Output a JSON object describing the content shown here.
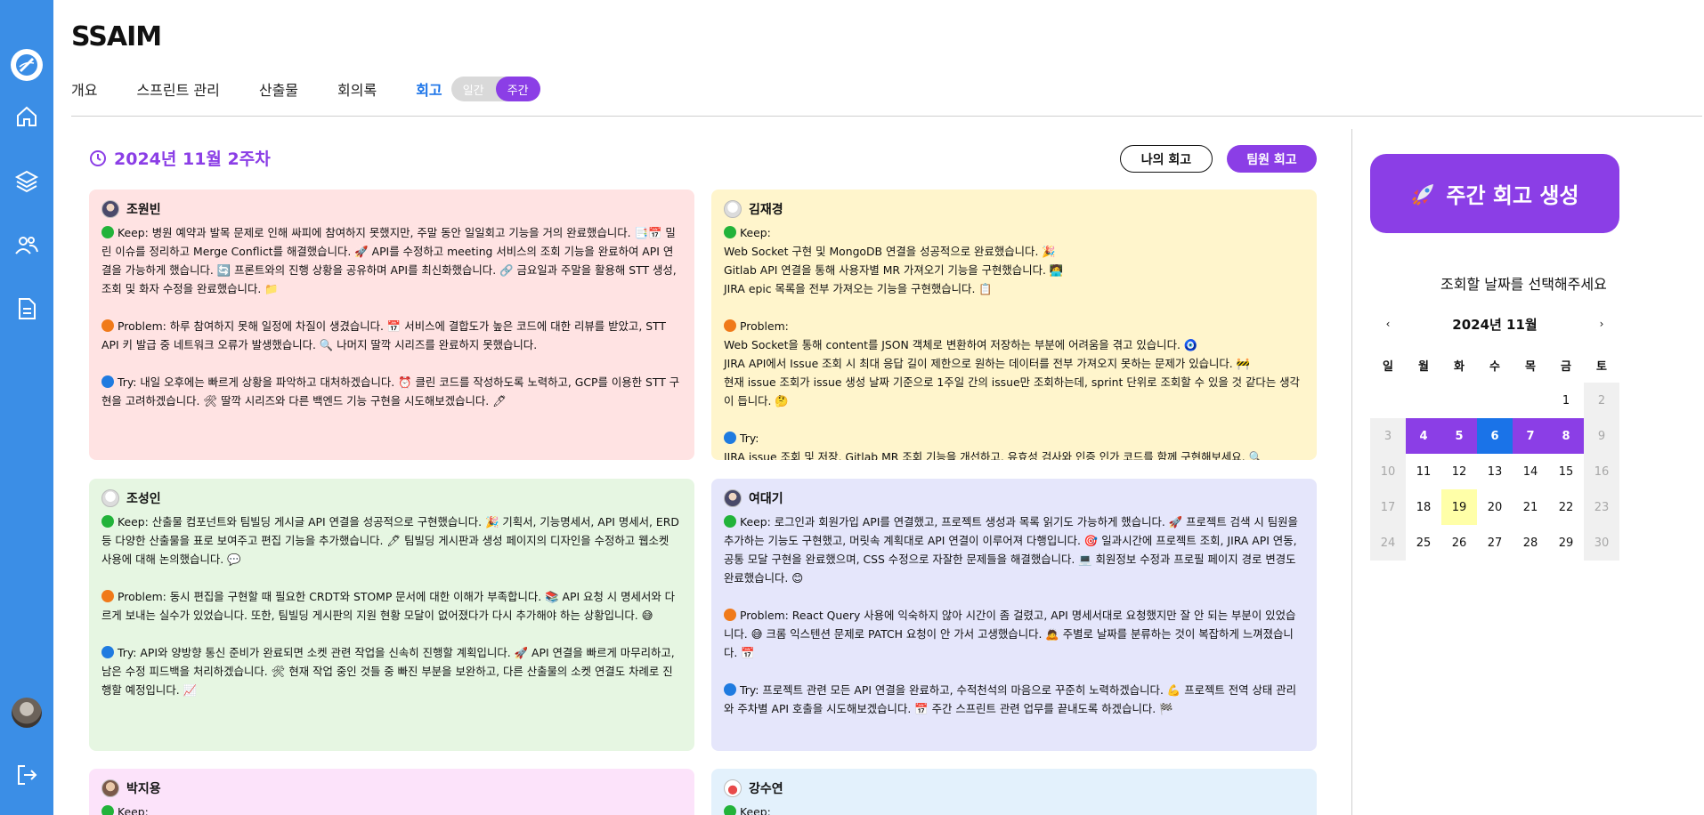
{
  "app": {
    "title": "SSAIM"
  },
  "tabs": [
    {
      "label": "개요"
    },
    {
      "label": "스프린트 관리"
    },
    {
      "label": "산출물"
    },
    {
      "label": "회의록"
    },
    {
      "label": "회고"
    }
  ],
  "toggle": {
    "daily": "일간",
    "weekly": "주간",
    "selected": "주간"
  },
  "week_label": "2024년 11월 2주차",
  "buttons": {
    "mine": "나의 회고",
    "team": "팀원 회고",
    "generate": "주간 회고 생성"
  },
  "cards": [
    {
      "name": "조원빈",
      "paras": [
        "Keep: 병원 예약과 발목 문제로 인해 싸피에 참여하지 못했지만, 주말 동안 일일회고 기능을 거의 완료했습니다. 📑📅 밀린 이슈를 정리하고 Merge Conflict를 해결했습니다. 🚀 API를 수정하고 meeting 서비스의 조회 기능을 완료하여 API 연결을 가능하게 했습니다. 🔄 프론트와의 진행 상황을 공유하며 API를 최신화했습니다. 🔗 금요일과 주말을 활용해 STT 생성, 조회 및 화자 수정을 완료했습니다. 📁",
        "Problem: 하루 참여하지 못해 일정에 차질이 생겼습니다. 📅 서비스에 결합도가 높은 코드에 대한 리뷰를 받았고, STT API 키 발급 중 네트워크 오류가 발생했습니다. 🔍 나머지 딸깍 시리즈를 완료하지 못했습니다.",
        "Try: 내일 오후에는 빠르게 상황을 파악하고 대처하겠습니다. ⏰ 클린 코드를 작성하도록 노력하고, GCP를 이용한 STT 구현을 고려하겠습니다. 🛠 딸깍 시리즈와 다른 백엔드 기능 구현을 시도해보겠습니다. 🖊"
      ]
    },
    {
      "name": "김재경",
      "paras": [
        "Keep:\nWeb Socket 구현 및 MongoDB 연결을 성공적으로 완료했습니다. 🎉\nGitlab API 연결을 통해 사용자별 MR 가져오기 기능을 구현했습니다. 🧑‍💻\nJIRA epic 목록을 전부 가져오는 기능을 구현했습니다. 📋",
        "Problem:\nWeb Socket을 통해 content를 JSON 객체로 변환하여 저장하는 부분에 어려움을 겪고 있습니다. 🧿\nJIRA API에서 Issue 조회 시 최대 응답 길이 제한으로 원하는 데이터를 전부 가져오지 못하는 문제가 있습니다. 🚧\n현재 issue 조회가 issue 생성 날짜 기준으로 1주일 간의 issue만 조회하는데, sprint 단위로 조회할 수 있을 것 같다는 생각이 듭니다. 🤔",
        "Try:\nJIRA issue 조회 및 저장, Gitlab MR 조회 기능을 개선하고, 유효성 검사와 인증 인가 코드를 함께 구현해보세요. 🔍"
      ]
    },
    {
      "name": "조성인",
      "paras": [
        "Keep: 산출물 컴포넌트와 팀빌딩 게시글 API 연결을 성공적으로 구현했습니다. 🎉 기획서, 기능명세서, API 명세서, ERD 등 다양한 산출물을 표로 보여주고 편집 기능을 추가했습니다. 🖊 팀빌딩 게시판과 생성 페이지의 디자인을 수정하고 웹소켓 사용에 대해 논의했습니다. 💬",
        "Problem: 동시 편집을 구현할 때 필요한 CRDT와 STOMP 문서에 대한 이해가 부족합니다. 📚 API 요청 시 명세서와 다르게 보내는 실수가 있었습니다. 또한, 팀빌딩 게시판의 지원 현황 모달이 없어졌다가 다시 추가해야 하는 상황입니다. 😅",
        "Try: API와 양방향 통신 준비가 완료되면 소켓 관련 작업을 신속히 진행할 계획입니다. 🚀 API 연결을 빠르게 마무리하고, 남은 수정 피드백을 처리하겠습니다. 🛠 현재 작업 중인 것들 중 빠진 부분을 보완하고, 다른 산출물의 소켓 연결도 차례로 진행할 예정입니다. 📈"
      ]
    },
    {
      "name": "여대기",
      "paras": [
        "Keep: 로그인과 회원가입 API를 연결했고, 프로젝트 생성과 목록 읽기도 가능하게 했습니다. 🚀 프로젝트 검색 시 팀원을 추가하는 기능도 구현했고, 머릿속 계획대로 API 연결이 이루어져 다행입니다. 🎯 일과시간에 프로젝트 조회, JIRA API 연동, 공통 모달 구현을 완료했으며, CSS 수정으로 자잘한 문제들을 해결했습니다. 💻 회원정보 수정과 프로필 페이지 경로 변경도 완료했습니다. 😊",
        "Problem: React Query 사용에 익숙하지 않아 시간이 좀 걸렸고, API 명세서대로 요청했지만 잘 안 되는 부분이 있었습니다. 😅 크롬 익스텐션 문제로 PATCH 요청이 안 가서 고생했습니다. 🙇 주별로 날짜를 분류하는 것이 복잡하게 느껴졌습니다. 📅",
        "Try: 프로젝트 관련 모든 API 연결을 완료하고, 수적천석의 마음으로 꾸준히 노력하겠습니다. 💪 프로젝트 전역 상태 관리와 주차별 API 호출을 시도해보겠습니다. 📅 주간 스프린트 관련 업무를 끝내도록 하겠습니다. 🏁"
      ]
    },
    {
      "name": "박지용",
      "paras": [
        "Keep:"
      ]
    },
    {
      "name": "강수연",
      "paras": [
        "Keep:"
      ]
    }
  ],
  "calendar": {
    "hint": "조회할 날짜를 선택해주세요",
    "month": "2024년 11월",
    "prev": "‹",
    "next": "›",
    "weekdays": [
      "일",
      "월",
      "화",
      "수",
      "목",
      "금",
      "토"
    ],
    "days": [
      "1",
      "2",
      "3",
      "4",
      "5",
      "6",
      "7",
      "8",
      "9",
      "10",
      "11",
      "12",
      "13",
      "14",
      "15",
      "16",
      "17",
      "18",
      "19",
      "20",
      "21",
      "22",
      "23",
      "24",
      "25",
      "26",
      "27",
      "28",
      "29",
      "30"
    ],
    "selected_week": [
      "4",
      "5",
      "6",
      "7",
      "8"
    ],
    "today": "6",
    "highlight": "19"
  },
  "colors": {
    "accent": "#8b3ee6",
    "sidebar": "#3b8ee6",
    "link": "#1a73e8"
  }
}
